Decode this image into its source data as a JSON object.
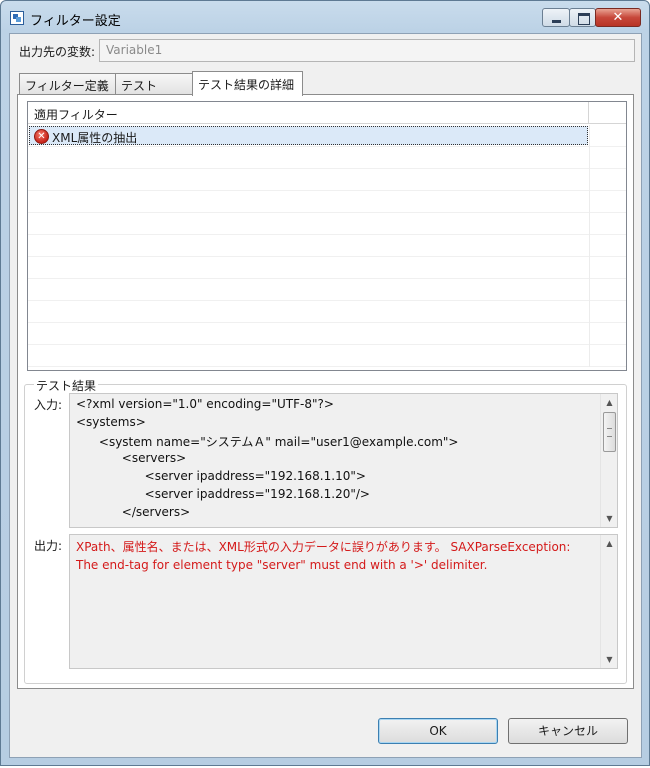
{
  "window": {
    "title": "フィルター設定"
  },
  "variable": {
    "label": "出力先の変数:",
    "value": "Variable1"
  },
  "tabs": [
    {
      "label": "フィルター定義",
      "active": false
    },
    {
      "label": "テスト",
      "active": false
    },
    {
      "label": "テスト結果の詳細",
      "active": true
    }
  ],
  "filter_list": {
    "header": "適用フィルター",
    "rows": [
      {
        "label": "XML属性の抽出",
        "status_icon": "error-icon",
        "selected": true
      }
    ]
  },
  "test_result": {
    "group_title": "テスト結果",
    "input_label": "入力:",
    "input_lines": [
      "<?xml version=\"1.0\" encoding=\"UTF-8\"?>",
      "<systems>",
      "      <system name=\"システムＡ\" mail=\"user1@example.com\">",
      "            <servers>",
      "                  <server ipaddress=\"192.168.1.10\">",
      "                  <server ipaddress=\"192.168.1.20\"/>",
      "            </servers>"
    ],
    "output_label": "出力:",
    "output_text": "XPath、属性名、または、XML形式の入力データに誤りがあります。 SAXParseException: The end-tag for element type \"server\" must end with a '>' delimiter."
  },
  "buttons": {
    "ok": "OK",
    "cancel": "キャンセル"
  },
  "colors": {
    "error_text": "#d41a1a",
    "selection": "#dbe9f8",
    "ok_border": "#3c7fb1"
  }
}
